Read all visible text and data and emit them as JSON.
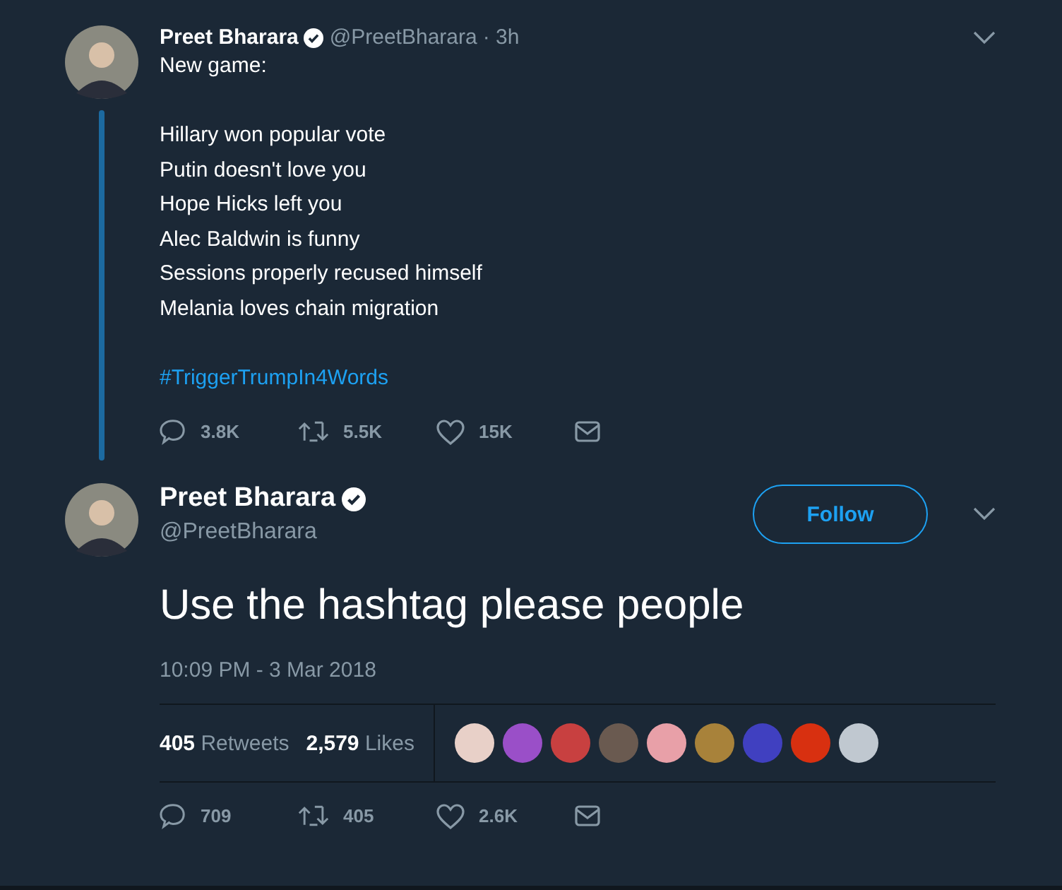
{
  "reply_tweet": {
    "name": "Preet Bharara",
    "handle": "@PreetBharara",
    "time": "· 3h",
    "paragraphs": [
      [
        "New game:"
      ],
      [
        "Hillary won popular vote",
        "Putin doesn't love you",
        "Hope Hicks left you",
        "Alec Baldwin is funny",
        "Sessions properly recused himself",
        "Melania loves chain migration"
      ]
    ],
    "hashtag": "#TriggerTrumpIn4Words",
    "actions": [
      {
        "kind": "reply",
        "count": "3.8K"
      },
      {
        "kind": "retweet",
        "count": "5.5K"
      },
      {
        "kind": "like",
        "count": "15K"
      },
      {
        "kind": "message"
      }
    ]
  },
  "main_tweet": {
    "name": "Preet Bharara",
    "handle": "@PreetBharara",
    "follow_button": "Follow",
    "text": "Use the hashtag please people",
    "timestamp": "10:09 PM - 3 Mar 2018",
    "stats": [
      {
        "count": "405",
        "label": "Retweets"
      },
      {
        "count": "2,579",
        "label": "Likes"
      }
    ],
    "likers": [
      {
        "color": "#e8d0c8"
      },
      {
        "color": "#9a4fc8"
      },
      {
        "color": "#c84040"
      },
      {
        "color": "#6a5a50"
      },
      {
        "color": "#e8a0a8"
      },
      {
        "color": "#a8823a"
      },
      {
        "color": "#4040c0"
      },
      {
        "color": "#d83010"
      },
      {
        "color": "#c0c8d0"
      }
    ],
    "actions": [
      {
        "kind": "reply",
        "count": "709"
      },
      {
        "kind": "retweet",
        "count": "405"
      },
      {
        "kind": "like",
        "count": "2.6K"
      },
      {
        "kind": "message"
      }
    ]
  }
}
